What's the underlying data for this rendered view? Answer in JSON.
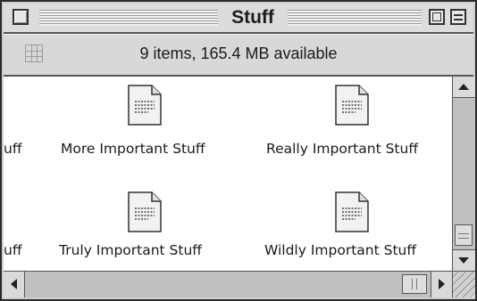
{
  "window": {
    "title": "Stuff"
  },
  "header": {
    "status": "9 items, 165.4 MB available",
    "view_icon": "icon-view-grid-icon"
  },
  "items": [
    {
      "label": "uff",
      "icon": "document-icon"
    },
    {
      "label": "More Important Stuff",
      "icon": "document-icon"
    },
    {
      "label": "Really Important Stuff",
      "icon": "document-icon"
    },
    {
      "label": "uff",
      "icon": "document-icon"
    },
    {
      "label": "Truly Important Stuff",
      "icon": "document-icon"
    },
    {
      "label": "Wildly Important Stuff",
      "icon": "document-icon"
    }
  ],
  "colors": {
    "window_frame": "#cfcfcf",
    "content_background": "#ffffff",
    "title_stripe": "#9a9a9a"
  }
}
